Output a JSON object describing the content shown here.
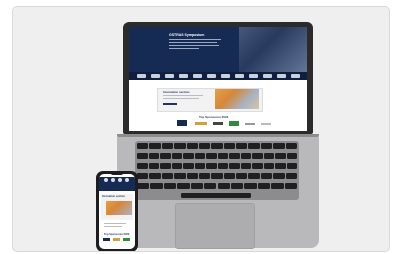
{
  "laptop_screen": {
    "hero_title": "GSTRAS Symposium",
    "highlight_title": "Innovation section",
    "sponsors_title": "Top Sponsoren 2023"
  },
  "phone_screen": {
    "highlight_title": "Innovation section",
    "sponsors_title": "Top Sponsoren 2023"
  },
  "colors": {
    "navy": "#152b53",
    "accent_orange": "#e7a046",
    "background": "#efefef"
  }
}
